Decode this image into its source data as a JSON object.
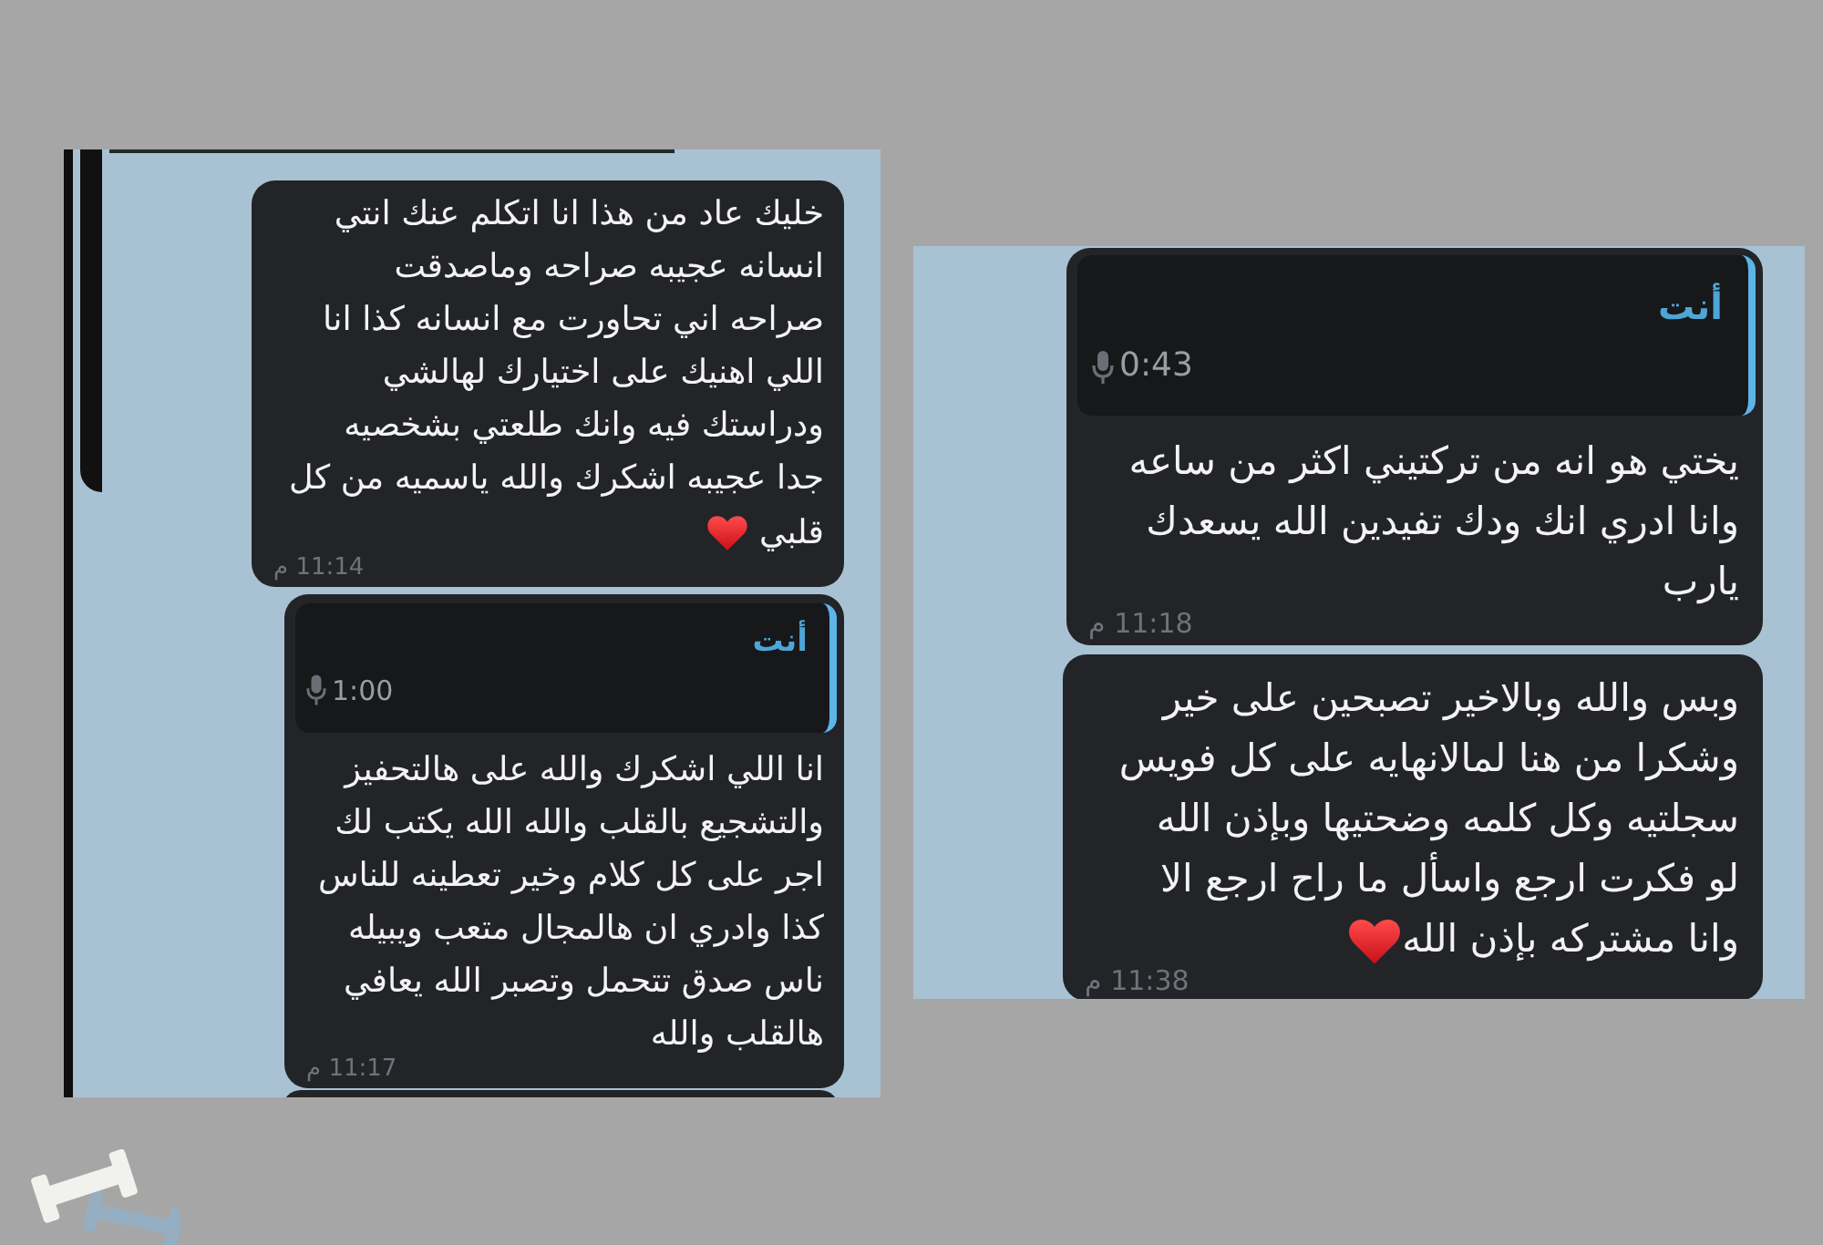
{
  "panels": [
    {
      "messages": [
        {
          "reply": {
            "kind": "voice",
            "sender": "أنت",
            "duration": "0:43"
          },
          "text": "يختي هو انه من تركتيني اكثر من ساعه\nوانا ادري انك ودك تفيدين الله يسعدك\nيارب",
          "time": "11:18 م"
        },
        {
          "text": "وبس والله وبالاخير تصبحين على خير\nوشكرا من هنا لمالانهايه على كل فويس\nسجلتيه وكل كلمه وضحتيها وبإذن الله\nلو فكرت ارجع واسأل ما راح ارجع الا\nوانا مشتركه بإذن الله",
          "heart_emoji": true,
          "time": "11:38 م"
        }
      ]
    },
    {
      "cut_off_above": true,
      "cut_off_below": true,
      "messages": [
        {
          "text": "خليك عاد من هذا انا اتكلم عنك انتي\nانسانه عجيبه صراحه وماصدقت\nصراحه اني تحاورت مع انسانه كذا انا\nاللي اهنيك على اختيارك لهالشي\nودراستك فيه وانك طلعتي بشخصيه\nجدا عجيبه اشكرك والله ياسميه من كل\nقلبي",
          "heart_emoji": true,
          "time": "11:14 م"
        },
        {
          "reply": {
            "kind": "voice",
            "sender": "أنت",
            "duration": "1:00"
          },
          "text": "انا اللي اشكرك والله على هالتحفيز\nوالتشجيع بالقلب والله الله يكتب لك\nاجر على كل كلام وخير تعطينه للناس\nكذا وادري ان هالمجال متعب ويبيله\nناس صدق تتحمل وتصبر الله يعافي\nهالقلب والله",
          "time": "11:17 م"
        }
      ]
    }
  ]
}
